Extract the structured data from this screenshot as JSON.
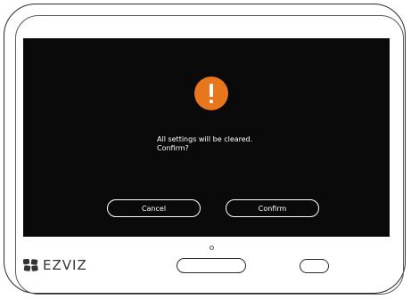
{
  "dialog": {
    "icon": "exclamation-warning-icon",
    "message_line1": "All settings will be cleared.",
    "message_line2": "Confirm?",
    "cancel_label": "Cancel",
    "confirm_label": "Confirm"
  },
  "device": {
    "brand": "EZVIZ",
    "brand_icon": "ezviz-logo-icon"
  },
  "colors": {
    "screen_background": "#0a0a0a",
    "warning_accent": "#e8761d",
    "text": "#ffffff"
  }
}
